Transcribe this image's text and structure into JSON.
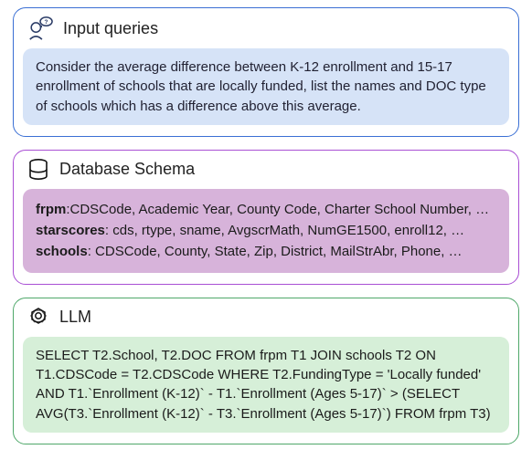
{
  "sections": {
    "input": {
      "title": "Input queries",
      "body": "Consider the average difference between K-12 enrollment and 15-17 enrollment of schools that are locally funded, list the names and DOC type of schools which has a difference above this average."
    },
    "schema": {
      "title": "Database Schema",
      "tables": [
        {
          "name": "frpm",
          "cols": ":CDSCode, Academic Year, County Code, Charter School Number, …"
        },
        {
          "name": "starscores",
          "cols": ":  cds, rtype, sname, AvgscrMath, NumGE1500, enroll12, …"
        },
        {
          "name": "schools",
          "cols": ": CDSCode, County, State, Zip, District, MailStrAbr, Phone, …"
        }
      ]
    },
    "llm": {
      "title": "LLM",
      "body": "SELECT T2.School, T2.DOC FROM frpm T1 JOIN schools T2 ON T1.CDSCode = T2.CDSCode WHERE T2.FundingType = 'Locally funded' AND T1.`Enrollment (K-12)` - T1.`Enrollment (Ages 5-17)` > (SELECT AVG(T3.`Enrollment (K-12)` - T3.`Enrollment (Ages 5-17)`) FROM frpm T3)"
    }
  }
}
